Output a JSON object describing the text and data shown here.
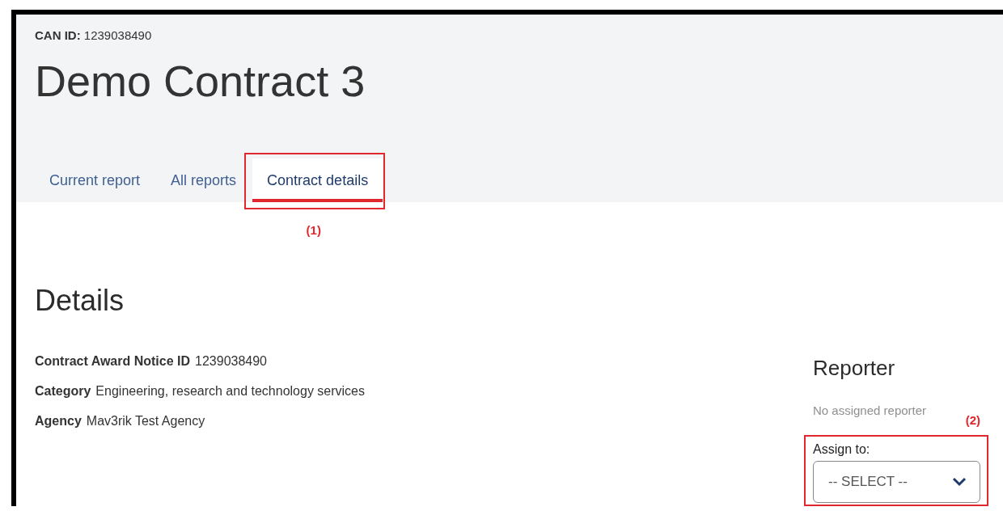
{
  "header": {
    "can_id_label": "CAN ID:",
    "can_id": "1239038490",
    "title": "Demo Contract 3"
  },
  "tabs": [
    {
      "label": "Current report",
      "selected": false
    },
    {
      "label": "All reports",
      "selected": false
    },
    {
      "label": "Contract details",
      "selected": true
    }
  ],
  "tab_callout": "(1)",
  "details": {
    "heading": "Details",
    "fields": [
      {
        "label": "Contract Award Notice ID",
        "value": "1239038490"
      },
      {
        "label": "Category",
        "value": "Engineering, research and technology services"
      },
      {
        "label": "Agency",
        "value": "Mav3rik Test Agency"
      }
    ]
  },
  "reporter": {
    "heading": "Reporter",
    "status": "No assigned reporter",
    "callout": "(2)",
    "assign_label": "Assign to:",
    "select_value": "-- SELECT --"
  }
}
